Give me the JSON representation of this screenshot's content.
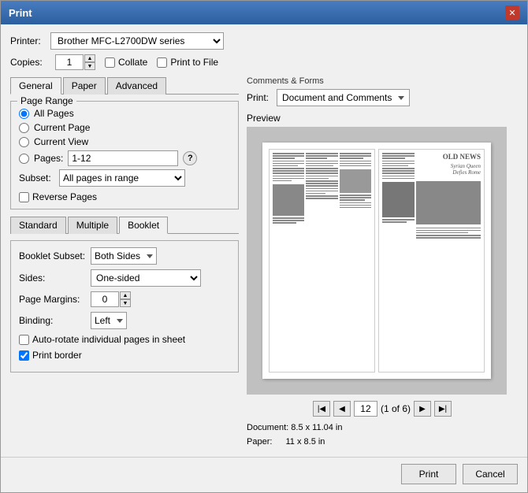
{
  "dialog": {
    "title": "Print",
    "close_label": "✕"
  },
  "printer": {
    "label": "Printer:",
    "value": "Brother MFC-L2700DW series"
  },
  "copies": {
    "label": "Copies:",
    "value": "1"
  },
  "collate_label": "Collate",
  "print_to_file_label": "Print to File",
  "tabs": {
    "general": "General",
    "paper": "Paper",
    "advanced": "Advanced"
  },
  "page_range": {
    "title": "Page Range",
    "all_pages": "All Pages",
    "current_page": "Current Page",
    "current_view": "Current View",
    "pages_label": "Pages:",
    "pages_value": "1-12",
    "subset_label": "Subset:",
    "subset_value": "All pages in range",
    "reverse_pages": "Reverse Pages"
  },
  "booklet_tabs": {
    "standard": "Standard",
    "multiple": "Multiple",
    "booklet": "Booklet"
  },
  "booklet": {
    "subset_label": "Booklet Subset:",
    "subset_value": "Both Sides",
    "sides_label": "Sides:",
    "sides_value": "One-sided",
    "margins_label": "Page Margins:",
    "margins_value": "0",
    "binding_label": "Binding:",
    "binding_value": "Left",
    "auto_rotate": "Auto-rotate individual pages in sheet",
    "print_border": "Print border"
  },
  "comments_forms": {
    "title": "Comments & Forms",
    "print_label": "Print:",
    "print_value": "Document and Comments"
  },
  "preview": {
    "label": "Preview",
    "page_current": "12",
    "page_of": "(1 of 6)",
    "headline": "OLD NEWS",
    "subheadline1": "Syrian Queen",
    "subheadline2": "Defies Rome"
  },
  "doc_info": {
    "document_label": "Document:",
    "document_value": "8.5 x 11.04 in",
    "paper_label": "Paper:",
    "paper_value": "11 x 8.5 in"
  },
  "footer": {
    "print_label": "Print",
    "cancel_label": "Cancel"
  }
}
